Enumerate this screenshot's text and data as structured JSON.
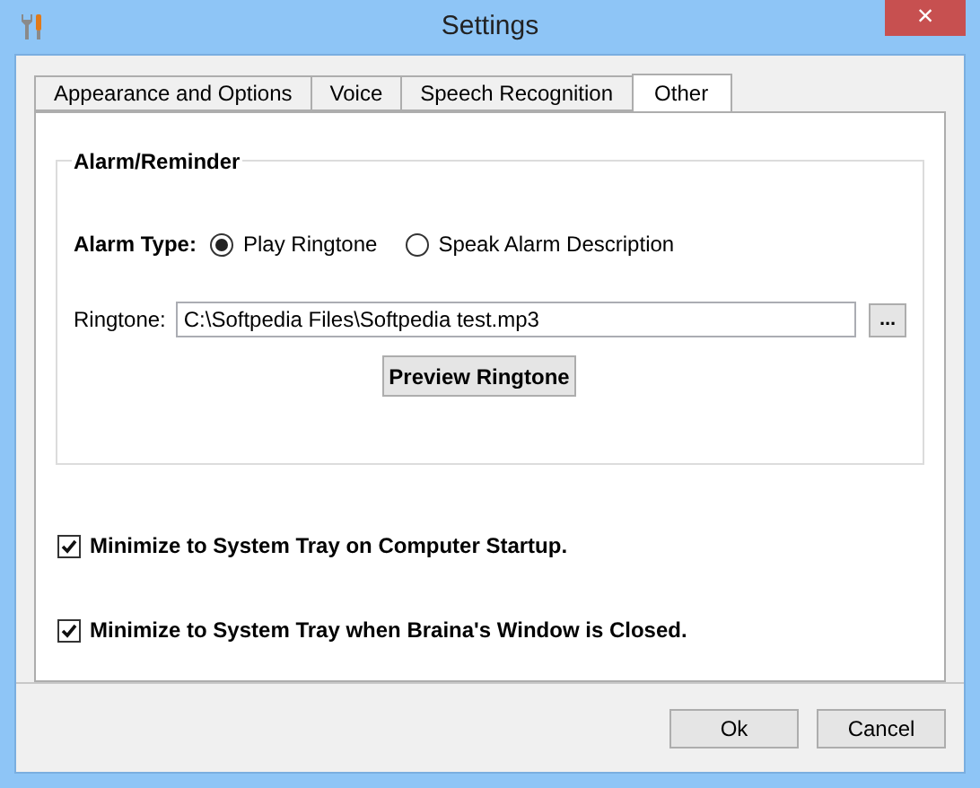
{
  "window": {
    "title": "Settings",
    "close": "×"
  },
  "tabs": [
    {
      "label": "Appearance and Options",
      "selected": false
    },
    {
      "label": "Voice",
      "selected": false
    },
    {
      "label": "Speech Recognition",
      "selected": false
    },
    {
      "label": "Other",
      "selected": true
    }
  ],
  "alarm_group": {
    "title": "Alarm/Reminder",
    "alarm_type_label": "Alarm Type:",
    "options": [
      {
        "label": "Play Ringtone",
        "selected": true
      },
      {
        "label": "Speak Alarm Description",
        "selected": false
      }
    ],
    "ringtone_label": "Ringtone:",
    "ringtone_value": "C:\\Softpedia Files\\Softpedia test.mp3",
    "browse": "...",
    "preview": "Preview Ringtone"
  },
  "checkboxes": [
    {
      "label": "Minimize to System Tray on Computer Startup.",
      "checked": true
    },
    {
      "label": "Minimize to System Tray when Braina's Window is Closed.",
      "checked": true
    }
  ],
  "buttons": [
    "Ok",
    "Cancel"
  ]
}
